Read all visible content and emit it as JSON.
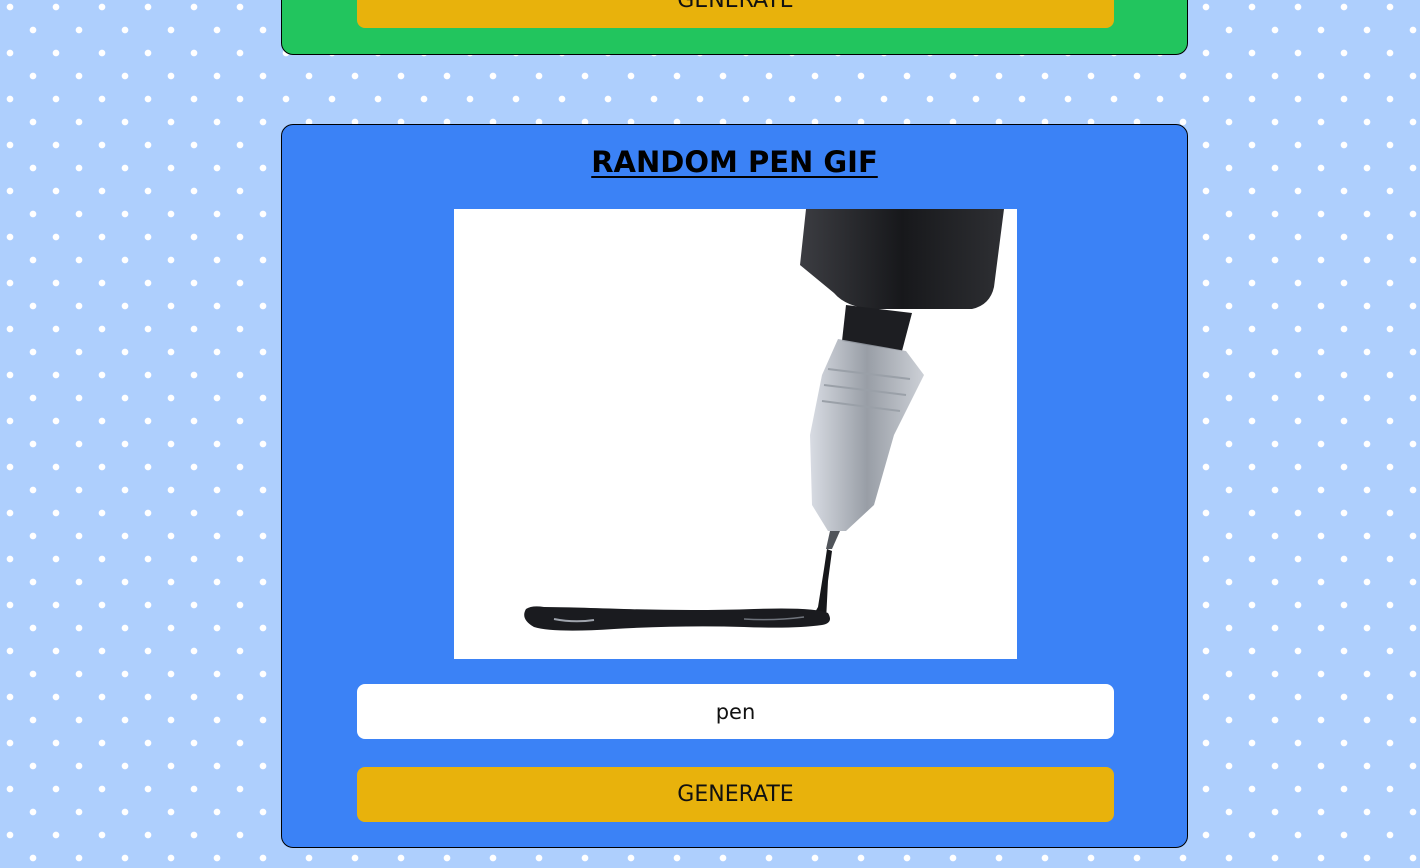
{
  "top_card": {
    "generate_label": "GENERATE",
    "color": "#22c55e"
  },
  "main_card": {
    "title": "RANDOM PEN GIF",
    "color": "#3b82f6",
    "gif": {
      "icon": "pen-ink-gif-image"
    },
    "search": {
      "value": "pen"
    },
    "generate_label": "GENERATE"
  },
  "colors": {
    "page_background": "#aecffd",
    "button": "#e8b20c",
    "input": "#ffffff"
  }
}
